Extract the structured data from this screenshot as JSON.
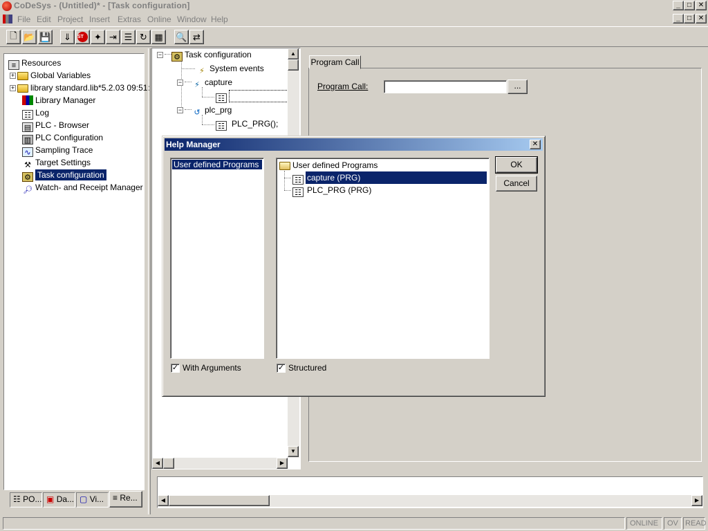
{
  "window": {
    "title": "CoDeSys - (Untitled)* - [Task configuration]",
    "controls": [
      "_",
      "□",
      "✕"
    ]
  },
  "menu": [
    "File",
    "Edit",
    "Project",
    "Insert",
    "Extras",
    "Online",
    "Window",
    "Help"
  ],
  "toolbar": {
    "buttons": [
      "new-icon",
      "open-icon",
      "save-icon",
      "login-icon",
      "stop-icon",
      "run-icon",
      "step-icon",
      "toggle-breakpoint-icon",
      "cycle-icon",
      "watch-icon",
      "find-icon",
      "replace-icon"
    ]
  },
  "resources": {
    "items": [
      {
        "label": "Resources",
        "icon": "resources-icon"
      },
      {
        "label": "Global Variables",
        "icon": "folder-icon"
      },
      {
        "label": "library standard.lib*5.2.03 09:51:",
        "icon": "folder-icon"
      },
      {
        "label": "Library Manager",
        "icon": "library-icon"
      },
      {
        "label": "Log",
        "icon": "log-icon"
      },
      {
        "label": "PLC - Browser",
        "icon": "browser-icon"
      },
      {
        "label": "PLC Configuration",
        "icon": "plc-config-icon"
      },
      {
        "label": "Sampling Trace",
        "icon": "trace-icon"
      },
      {
        "label": "Target Settings",
        "icon": "target-icon"
      },
      {
        "label": "Task configuration",
        "icon": "task-config-icon"
      },
      {
        "label": "Watch- and Receipt Manager",
        "icon": "watch-icon"
      }
    ],
    "tabs": [
      "PO...",
      "Da...",
      "Vi...",
      "Re..."
    ]
  },
  "task_tree": {
    "root": "Task configuration",
    "system_events": "System events",
    "task1": "capture",
    "task2": "plc_prg",
    "call2": "PLC_PRG();"
  },
  "program_call_panel": {
    "tab": "Program Call",
    "label": "Program Call:",
    "value": "",
    "browse": "..."
  },
  "dialog": {
    "title": "Help Manager",
    "close": "✕",
    "left_list": [
      "User defined Programs"
    ],
    "right_root": "User defined Programs",
    "right_items": [
      "capture (PRG)",
      "PLC_PRG (PRG)"
    ],
    "ok": "OK",
    "cancel": "Cancel",
    "with_arguments": "With Arguments",
    "structured": "Structured"
  },
  "statusbar": {
    "mode": "ONLINE",
    "ov": "OV",
    "read": "READ"
  }
}
